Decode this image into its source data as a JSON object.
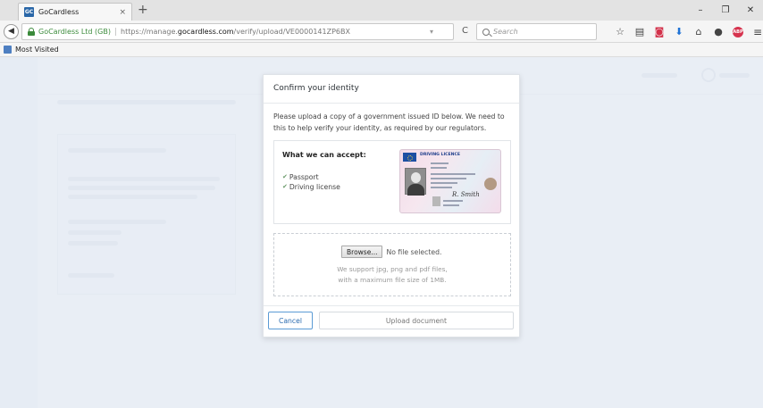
{
  "browser": {
    "tab_title": "GoCardless",
    "tab_favicon": "GC",
    "tab_close": "×",
    "new_tab": "+",
    "identity": "GoCardless Ltd (GB)",
    "url_prefix": "https://manage.",
    "url_domain": "gocardless.com",
    "url_path": "/verify/upload/VE0000141ZP6BX",
    "search_placeholder": "Search",
    "bookmark_label": "Most Visited",
    "window_controls": [
      "–",
      "❐",
      "✕"
    ],
    "icons": [
      "star-icon",
      "reading-list-icon",
      "pocket-icon",
      "download-icon",
      "home-icon",
      "chat-icon",
      "adblock-icon",
      "menu-icon"
    ]
  },
  "modal": {
    "title": "Confirm your identity",
    "description": "Please upload a copy of a government issued ID below. We need to this to help verify your identity, as required by our regulators.",
    "accept_heading": "What we can accept:",
    "accepted": [
      "Passport",
      "Driving license"
    ],
    "licence_title": "DRIVING LICENCE",
    "licence_signature": "R. Smith",
    "browse_label": "Browse...",
    "no_file": "No file selected.",
    "support_line1": "We support jpg, png and pdf files,",
    "support_line2": "with a maximum file size of 1MB.",
    "cancel_label": "Cancel",
    "upload_label": "Upload document"
  },
  "colors": {
    "overlay": "#e4eaf2",
    "cancel_accent": "#2b6cb0",
    "secure_green": "#3d8c3d"
  }
}
